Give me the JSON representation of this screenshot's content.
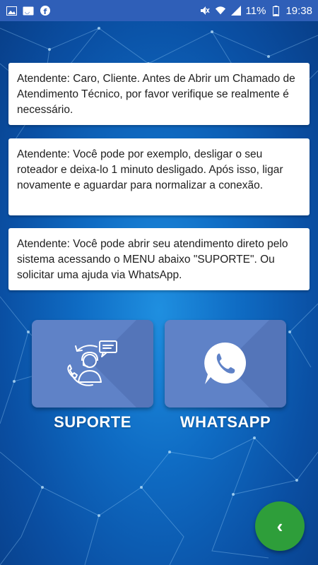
{
  "statusbar": {
    "battery_text": "11%",
    "time": "19:38",
    "left_icons": [
      "gallery-icon",
      "cast-icon",
      "facebook-icon"
    ],
    "right_icons": [
      "mute-icon",
      "wifi-icon",
      "signal-icon",
      "battery-icon"
    ]
  },
  "messages": [
    {
      "text": "Atendente: Caro, Cliente. Antes de Abrir um Chamado de Atendimento Técnico, por favor verifique se realmente é necessário."
    },
    {
      "text": "Atendente: Você pode por exemplo, desligar o seu roteador e deixa-lo 1 minuto desligado. Após isso, ligar novamente e aguardar para normalizar a conexão."
    },
    {
      "text": "Atendente: Você pode abrir seu atendimento direto pelo sistema acessando o MENU abaixo \"SUPORTE\". Ou solicitar uma ajuda via WhatsApp."
    }
  ],
  "actions": {
    "support_label": "SUPORTE",
    "whatsapp_label": "WHATSAPP"
  },
  "fab": {
    "icon": "chevron-left-icon",
    "glyph": "‹"
  },
  "colors": {
    "statusbar": "#2f5fb8",
    "background": "#0f6cc4",
    "tile": "#5f82c7",
    "fab": "#2e9e3a"
  }
}
